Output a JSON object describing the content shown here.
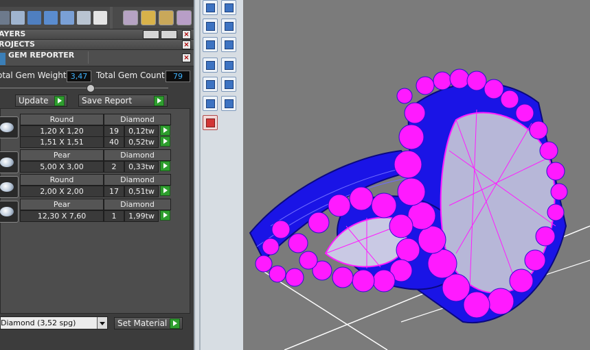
{
  "panels": {
    "layers_title": "AYERS",
    "projects_title": "ROJECTS",
    "gem_reporter_title": "GEM REPORTER"
  },
  "totals": {
    "weight_label": "otal Gem Weight",
    "weight_value": "3,47",
    "count_label": "Total Gem Count",
    "count_value": "79"
  },
  "actions": {
    "update_label": "Update",
    "save_label": "Save Report",
    "set_material_label": "Set Material"
  },
  "material": {
    "selected": "Diamond   (3,52 spg)"
  },
  "gems": [
    {
      "shape": "Round",
      "material": "Diamond",
      "rows": [
        {
          "size": "1,20 X 1,20",
          "count": "19",
          "weight": "0,12tw"
        },
        {
          "size": "1,51 X 1,51",
          "count": "40",
          "weight": "0,52tw"
        }
      ]
    },
    {
      "shape": "Pear",
      "material": "Diamond",
      "rows": [
        {
          "size": "5,00 X 3,00",
          "count": "2",
          "weight": "0,33tw"
        }
      ]
    },
    {
      "shape": "Round",
      "material": "Diamond",
      "rows": [
        {
          "size": "2,00 X 2,00",
          "count": "17",
          "weight": "0,51tw"
        }
      ]
    },
    {
      "shape": "Pear",
      "material": "Diamond",
      "rows": [
        {
          "size": "12,30 X 7,60",
          "count": "1",
          "weight": "1,99tw"
        }
      ]
    }
  ],
  "colors": {
    "value_text": "#3fb4ff",
    "wire_blue": "#1a14e6",
    "gem_magenta": "#ff1aff",
    "go_green": "#2e9e2e"
  }
}
